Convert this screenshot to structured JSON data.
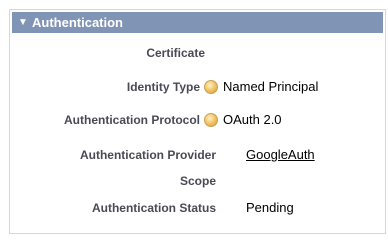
{
  "section": {
    "toggle_icon": "triangle-down",
    "title": "Authentication"
  },
  "fields": [
    {
      "label": "Certificate",
      "value": "",
      "help": false
    },
    {
      "label": "Identity Type",
      "value": "Named Principal",
      "help": true
    },
    {
      "label": "Authentication Protocol",
      "value": "OAuth 2.0",
      "help": true
    },
    {
      "label": "Authentication Provider",
      "value": "GoogleAuth",
      "help": false,
      "link": true
    },
    {
      "label": "Scope",
      "value": "",
      "help": false
    },
    {
      "label": "Authentication Status",
      "value": "Pending",
      "help": false
    }
  ],
  "colors": {
    "header_bg": "#8094b6",
    "label_text": "#4a4a56",
    "help_icon": "#f3c76e"
  }
}
